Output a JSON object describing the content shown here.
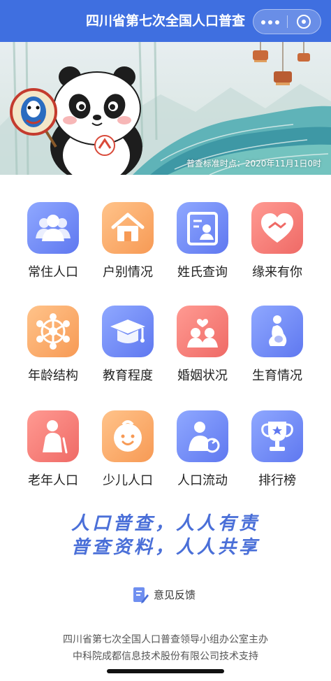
{
  "header": {
    "title": "四川省第七次全国人口普查"
  },
  "banner": {
    "census_time": "普查标准时点：2020年11月1日0时"
  },
  "grid": [
    {
      "label": "常住人口",
      "icon": "people-icon",
      "color": "blue"
    },
    {
      "label": "户别情况",
      "icon": "house-icon",
      "color": "orange"
    },
    {
      "label": "姓氏查询",
      "icon": "id-card-icon",
      "color": "blue"
    },
    {
      "label": "缘来有你",
      "icon": "heart-icon",
      "color": "red"
    },
    {
      "label": "年龄结构",
      "icon": "network-icon",
      "color": "orange"
    },
    {
      "label": "教育程度",
      "icon": "graduation-cap-icon",
      "color": "blue"
    },
    {
      "label": "婚姻状况",
      "icon": "couple-icon",
      "color": "red"
    },
    {
      "label": "生育情况",
      "icon": "pregnant-icon",
      "color": "blue"
    },
    {
      "label": "老年人口",
      "icon": "elder-icon",
      "color": "red"
    },
    {
      "label": "少儿人口",
      "icon": "child-face-icon",
      "color": "orange"
    },
    {
      "label": "人口流动",
      "icon": "person-flow-icon",
      "color": "blue"
    },
    {
      "label": "排行榜",
      "icon": "trophy-icon",
      "color": "blue"
    }
  ],
  "slogan": {
    "line1": "人口普查，人人有责",
    "line2": "普查资料，人人共享"
  },
  "feedback": {
    "label": "意见反馈"
  },
  "footer": {
    "line1": "四川省第七次全国人口普查领导小组办公室主办",
    "line2": "中科院成都信息技术股份有限公司技术支持"
  },
  "colors": {
    "header": "#3f6fe0",
    "slogan": "#4a6fd8",
    "blue": "#6f88f5",
    "orange": "#f9a764",
    "red": "#f27a74"
  }
}
